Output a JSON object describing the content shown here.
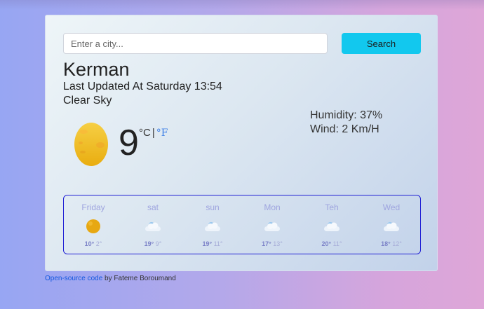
{
  "search": {
    "placeholder": "Enter a city...",
    "button_label": "Search"
  },
  "current": {
    "city": "Kerman",
    "last_updated": "Last Updated At Saturday 13:54",
    "description": "Clear Sky",
    "temperature": "9",
    "unit_celsius": "°C",
    "separator": "|",
    "unit_fahrenheit": "°F",
    "humidity": "Humidity: 37%",
    "wind": "Wind: 2 Km/H",
    "icon": "sun-icon"
  },
  "forecast": [
    {
      "day": "Friday",
      "max": "10°",
      "min": "2°",
      "icon": "sun-icon"
    },
    {
      "day": "sat",
      "max": "19°",
      "min": "9°",
      "icon": "cloud-icon"
    },
    {
      "day": "sun",
      "max": "19°",
      "min": "11°",
      "icon": "cloud-icon"
    },
    {
      "day": "Mon",
      "max": "17°",
      "min": "13°",
      "icon": "cloud-icon"
    },
    {
      "day": "Teh",
      "max": "20°",
      "min": "11°",
      "icon": "cloud-icon"
    },
    {
      "day": "Wed",
      "max": "18°",
      "min": "12°",
      "icon": "cloud-icon"
    }
  ],
  "footer": {
    "link_text": "Open-source code",
    "author_text": " by Fateme Boroumand"
  },
  "colors": {
    "accent": "#12c8ee",
    "link": "#1458df",
    "forecast_border": "#1f1fd4"
  }
}
